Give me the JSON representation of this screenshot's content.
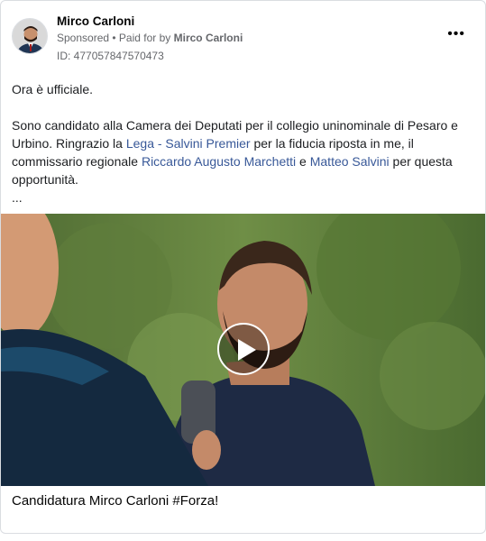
{
  "post": {
    "author": "Mirco Carloni",
    "sponsored_label": "Sponsored",
    "separator": " • ",
    "paid_for_prefix": "Paid for by ",
    "paid_for_name": "Mirco Carloni",
    "ad_id": "ID: 477057847570473",
    "more_icon": "•••",
    "text": {
      "line1": "Ora è ufficiale.",
      "p2_part1": "Sono candidato alla Camera dei Deputati per il collegio uninominale di Pesaro e Urbino. Ringrazio la ",
      "link1": "Lega - Salvini Premier",
      "p2_part2": " per la fiducia riposta in me, il commissario regionale ",
      "link2": "Riccardo Augusto Marchetti",
      "p2_part3": " e ",
      "link3": "Matteo Salvini",
      "p2_part4": " per questa opportunità.",
      "ellipsis": "..."
    },
    "media_caption": "Candidatura Mirco Carloni #Forza!"
  }
}
